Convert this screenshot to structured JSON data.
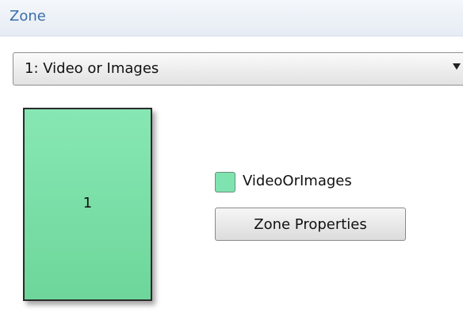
{
  "header": {
    "title": "Zone"
  },
  "zone_select": {
    "value": "1: Video or Images",
    "icon": "dropdown-arrow-icon"
  },
  "zone_preview": {
    "number": "1",
    "color": "#7fe3b0"
  },
  "legend": {
    "label": "VideoOrImages",
    "swatch_color": "#7fe3b0"
  },
  "actions": {
    "zone_properties_label": "Zone Properties"
  }
}
